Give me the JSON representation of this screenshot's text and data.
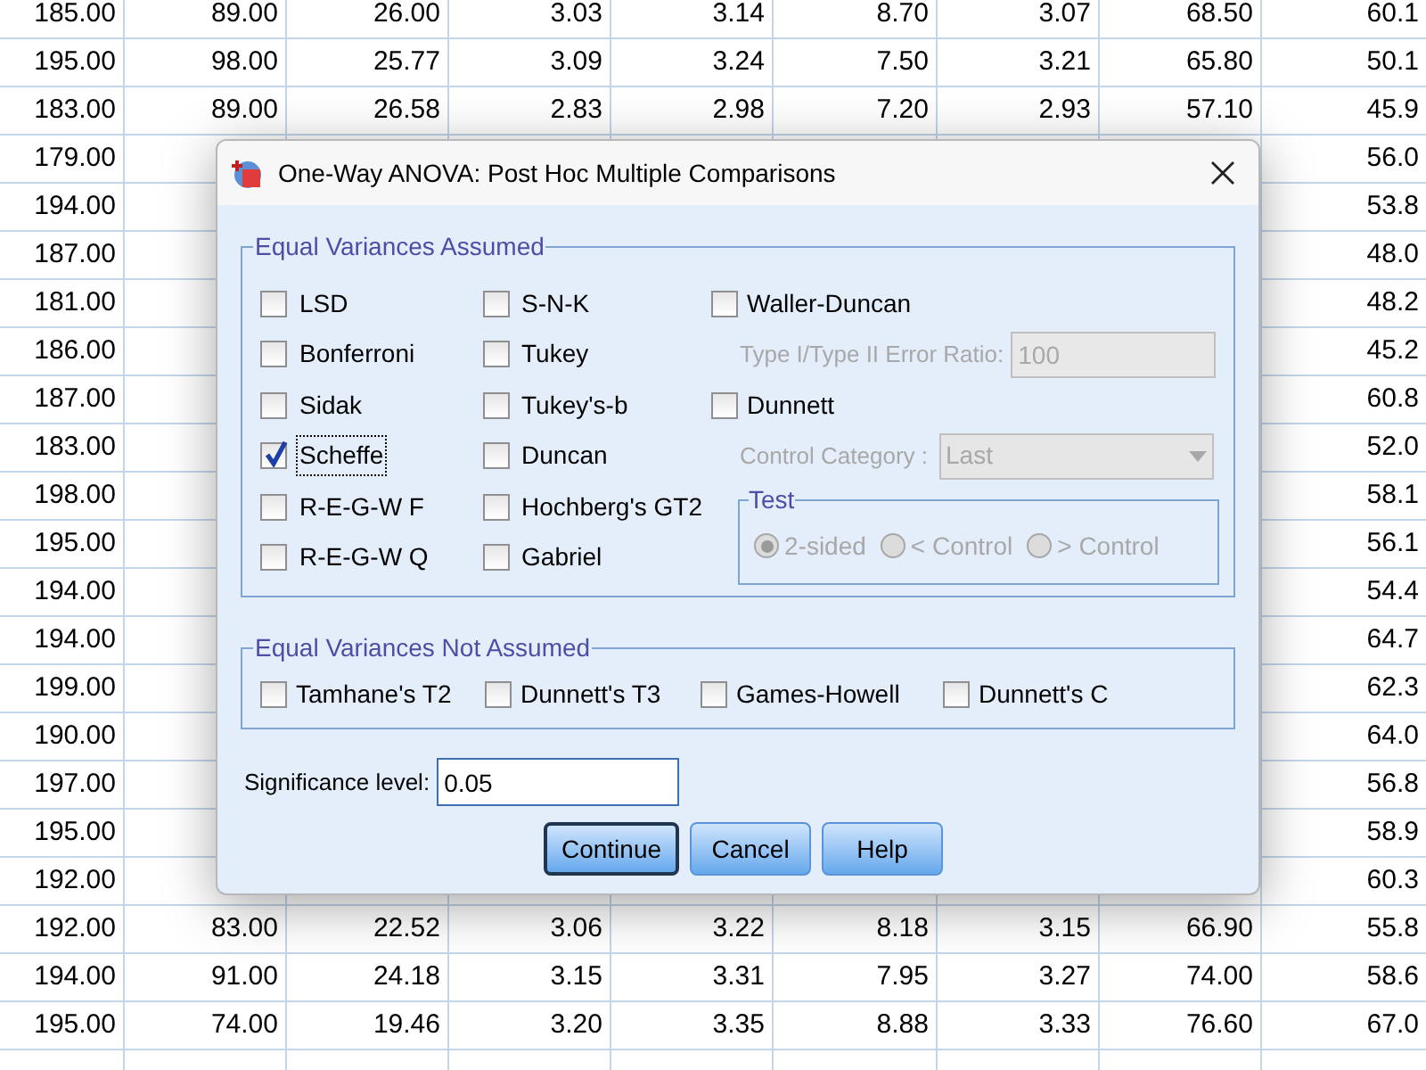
{
  "grid": {
    "rows": [
      {
        "cells": [
          "185.00",
          "89.00",
          "26.00",
          "3.03",
          "3.14",
          "8.70",
          "3.07",
          "68.50",
          "60.1"
        ]
      },
      {
        "cells": [
          "195.00",
          "98.00",
          "25.77",
          "3.09",
          "3.24",
          "7.50",
          "3.21",
          "65.80",
          "50.1"
        ]
      },
      {
        "cells": [
          "183.00",
          "89.00",
          "26.58",
          "2.83",
          "2.98",
          "7.20",
          "2.93",
          "57.10",
          "45.9"
        ]
      },
      {
        "cells": [
          "179.00",
          null,
          null,
          null,
          null,
          null,
          null,
          null,
          "56.0"
        ]
      },
      {
        "cells": [
          "194.00",
          null,
          null,
          null,
          null,
          null,
          null,
          null,
          "53.8"
        ]
      },
      {
        "cells": [
          "187.00",
          null,
          null,
          null,
          null,
          null,
          null,
          null,
          "48.0"
        ]
      },
      {
        "cells": [
          "181.00",
          null,
          null,
          null,
          null,
          null,
          null,
          null,
          "48.2"
        ]
      },
      {
        "cells": [
          "186.00",
          null,
          null,
          null,
          null,
          null,
          null,
          null,
          "45.2"
        ]
      },
      {
        "cells": [
          "187.00",
          null,
          null,
          null,
          null,
          null,
          null,
          null,
          "60.8"
        ]
      },
      {
        "cells": [
          "183.00",
          null,
          null,
          null,
          null,
          null,
          null,
          null,
          "52.0"
        ]
      },
      {
        "cells": [
          "198.00",
          null,
          null,
          null,
          null,
          null,
          null,
          null,
          "58.1"
        ]
      },
      {
        "cells": [
          "195.00",
          null,
          null,
          null,
          null,
          null,
          null,
          null,
          "56.1"
        ]
      },
      {
        "cells": [
          "194.00",
          null,
          null,
          null,
          null,
          null,
          null,
          null,
          "54.4"
        ]
      },
      {
        "cells": [
          "194.00",
          null,
          null,
          null,
          null,
          null,
          null,
          null,
          "64.7"
        ]
      },
      {
        "cells": [
          "199.00",
          null,
          null,
          null,
          null,
          null,
          null,
          null,
          "62.3"
        ]
      },
      {
        "cells": [
          "190.00",
          null,
          null,
          null,
          null,
          null,
          null,
          null,
          "64.0"
        ]
      },
      {
        "cells": [
          "197.00",
          null,
          null,
          null,
          null,
          null,
          null,
          null,
          "56.8"
        ]
      },
      {
        "cells": [
          "195.00",
          null,
          null,
          null,
          null,
          null,
          null,
          null,
          "58.9"
        ]
      },
      {
        "cells": [
          "192.00",
          null,
          null,
          null,
          null,
          null,
          null,
          null,
          "60.3"
        ]
      },
      {
        "cells": [
          "192.00",
          "83.00",
          "22.52",
          "3.06",
          "3.22",
          "8.18",
          "3.15",
          "66.90",
          "55.8"
        ]
      },
      {
        "cells": [
          "194.00",
          "91.00",
          "24.18",
          "3.15",
          "3.31",
          "7.95",
          "3.27",
          "74.00",
          "58.6"
        ]
      },
      {
        "cells": [
          "195.00",
          "74.00",
          "19.46",
          "3.20",
          "3.35",
          "8.88",
          "3.33",
          "76.60",
          "67.0"
        ]
      }
    ]
  },
  "dialog": {
    "title": "One-Way ANOVA: Post Hoc Multiple Comparisons",
    "equal_variances_assumed": {
      "title": "Equal Variances Assumed",
      "columns": [
        [
          {
            "label": "LSD",
            "checked": false,
            "focused": false
          },
          {
            "label": "Bonferroni",
            "checked": false,
            "focused": false
          },
          {
            "label": "Sidak",
            "checked": false,
            "focused": false
          },
          {
            "label": "Scheffe",
            "checked": true,
            "focused": true
          },
          {
            "label": "R-E-G-W F",
            "checked": false,
            "focused": false
          },
          {
            "label": "R-E-G-W Q",
            "checked": false,
            "focused": false
          }
        ],
        [
          {
            "label": "S-N-K",
            "checked": false,
            "focused": false
          },
          {
            "label": "Tukey",
            "checked": false,
            "focused": false
          },
          {
            "label": "Tukey's-b",
            "checked": false,
            "focused": false
          },
          {
            "label": "Duncan",
            "checked": false,
            "focused": false
          },
          {
            "label": "Hochberg's GT2",
            "checked": false,
            "focused": false
          },
          {
            "label": "Gabriel",
            "checked": false,
            "focused": false
          }
        ]
      ],
      "waller_duncan": {
        "label": "Waller-Duncan",
        "checked": false
      },
      "error_ratio": {
        "label": "Type I/Type II Error Ratio:",
        "value": "100",
        "disabled": true
      },
      "dunnett": {
        "label": "Dunnett",
        "checked": false
      },
      "control_category": {
        "label": "Control Category :",
        "value": "Last",
        "disabled": true
      },
      "test": {
        "title": "Test",
        "disabled": true,
        "options": [
          {
            "label": "2-sided",
            "selected": true
          },
          {
            "label": "< Control",
            "selected": false
          },
          {
            "label": "> Control",
            "selected": false
          }
        ]
      }
    },
    "equal_variances_not_assumed": {
      "title": "Equal Variances Not Assumed",
      "options": [
        {
          "label": "Tamhane's T2",
          "checked": false
        },
        {
          "label": "Dunnett's T3",
          "checked": false
        },
        {
          "label": "Games-Howell",
          "checked": false
        },
        {
          "label": "Dunnett's C",
          "checked": false
        }
      ]
    },
    "significance": {
      "label": "Significance level:",
      "value": "0.05"
    },
    "buttons": [
      {
        "label": "Continue",
        "default": true
      },
      {
        "label": "Cancel",
        "default": false
      },
      {
        "label": "Help",
        "default": false
      }
    ]
  }
}
